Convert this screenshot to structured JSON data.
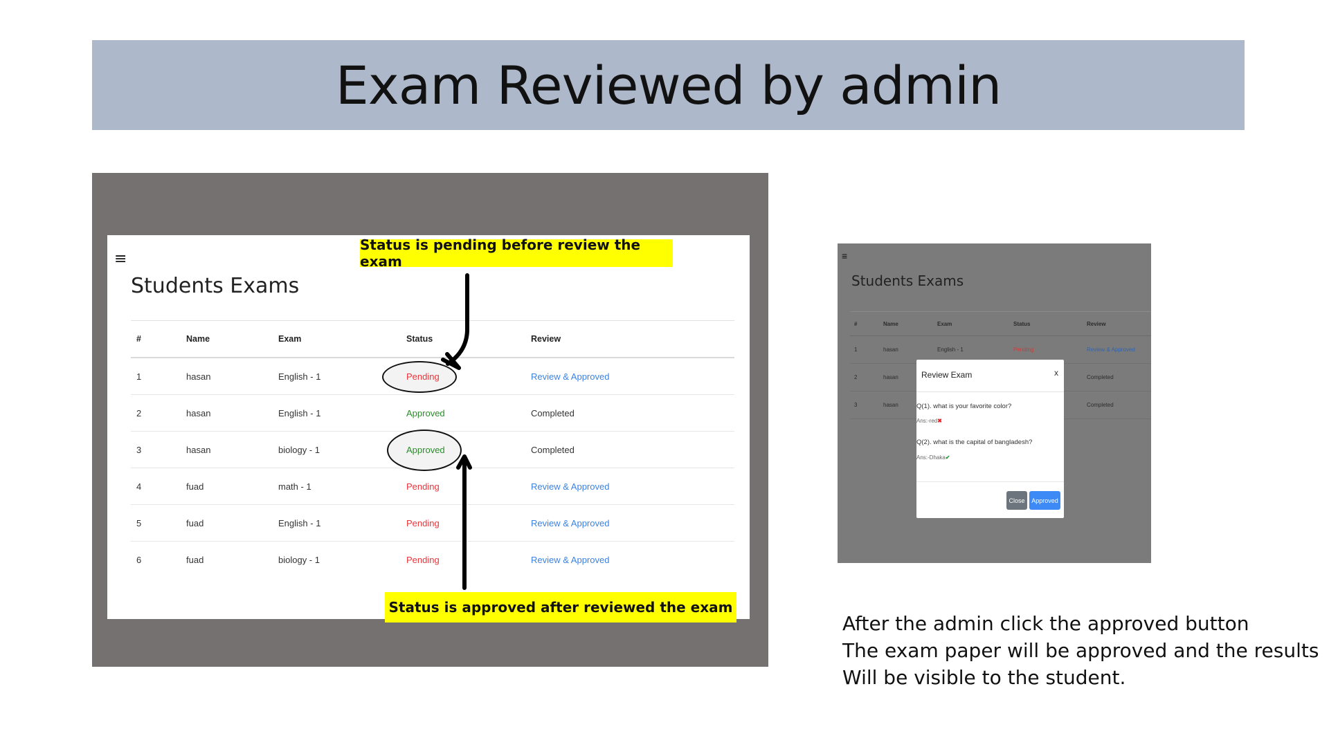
{
  "slide_title": "Exam Reviewed by admin",
  "left_shot": {
    "hamburger": "≡",
    "title": "Students Exams",
    "headers": [
      "#",
      "Name",
      "Exam",
      "Status",
      "Review"
    ],
    "rows": [
      {
        "n": "1",
        "name": "hasan",
        "exam": "English - 1",
        "status": "Pending",
        "review": "Review & Approved"
      },
      {
        "n": "2",
        "name": "hasan",
        "exam": "English - 1",
        "status": "Approved",
        "review": "Completed"
      },
      {
        "n": "3",
        "name": "hasan",
        "exam": "biology - 1",
        "status": "Approved",
        "review": "Completed"
      },
      {
        "n": "4",
        "name": "fuad",
        "exam": "math - 1",
        "status": "Pending",
        "review": "Review & Approved"
      },
      {
        "n": "5",
        "name": "fuad",
        "exam": "English - 1",
        "status": "Pending",
        "review": "Review & Approved"
      },
      {
        "n": "6",
        "name": "fuad",
        "exam": "biology - 1",
        "status": "Pending",
        "review": "Review & Approved"
      }
    ]
  },
  "callouts": {
    "top": "Status is pending before review the exam",
    "bottom": "Status is approved after reviewed the exam"
  },
  "right_shot": {
    "hamburger": "≡",
    "title": "Students Exams",
    "headers": [
      "#",
      "Name",
      "Exam",
      "Status",
      "Review"
    ],
    "rows": [
      {
        "n": "1",
        "name": "hasan",
        "exam": "English - 1",
        "status": "Pending",
        "review": "Review & Approved"
      },
      {
        "n": "2",
        "name": "hasan",
        "exam": "",
        "status": "",
        "review": "Completed"
      },
      {
        "n": "3",
        "name": "hasan",
        "exam": "",
        "status": "",
        "review": "Completed"
      }
    ],
    "modal": {
      "title": "Review Exam",
      "close_x": "x",
      "q1": "Q(1). what is your favorite color?",
      "a1": "Ans:-red",
      "q2": "Q(2). what is the capital of bangladesh?",
      "a2": "Ans:-Dhaka",
      "close_button": "Close",
      "approved_button": "Approved"
    }
  },
  "caption": {
    "line1": "After the admin click the approved button",
    "line2": "The exam paper will be approved and the results",
    "line3": "Will be visible to the student."
  },
  "colors": {
    "title_bar": "#adb9ca",
    "screenshot_bg": "#767171",
    "callout": "#ffff00",
    "pending": "#e8343a",
    "approved": "#2a8b2a",
    "link": "#3b82e0",
    "approve_button": "#3d8af7",
    "close_button": "#6c757d"
  }
}
